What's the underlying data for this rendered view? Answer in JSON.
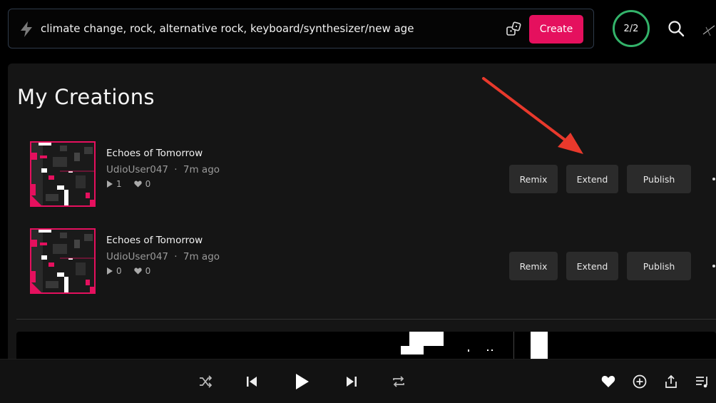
{
  "prompt": {
    "text": "climate change, rock, alternative rock, keyboard/synthesizer/new age",
    "create_label": "Create"
  },
  "credits": {
    "label": "2/2"
  },
  "page": {
    "title": "My Creations"
  },
  "songs": [
    {
      "title": "Echoes of Tomorrow",
      "user": "UdioUser047",
      "age": "7m ago",
      "plays": "1",
      "likes": "0"
    },
    {
      "title": "Echoes of Tomorrow",
      "user": "UdioUser047",
      "age": "7m ago",
      "plays": "0",
      "likes": "0"
    }
  ],
  "actions": {
    "remix": "Remix",
    "extend": "Extend",
    "publish": "Publish"
  },
  "separator": "·",
  "icons": {
    "prompt": "lightning-icon",
    "random": "dice-icon",
    "search": "search-icon",
    "shuffle": "shuffle-icon",
    "prev": "skip-back-icon",
    "play": "play-icon",
    "next": "skip-forward-icon",
    "repeat": "repeat-icon",
    "like": "heart-icon",
    "add": "add-circle-icon",
    "share": "share-icon",
    "queue": "queue-icon"
  },
  "colors": {
    "accent": "#e5105e",
    "credits_ring": "#33b36a",
    "arrow": "#e8392c"
  }
}
